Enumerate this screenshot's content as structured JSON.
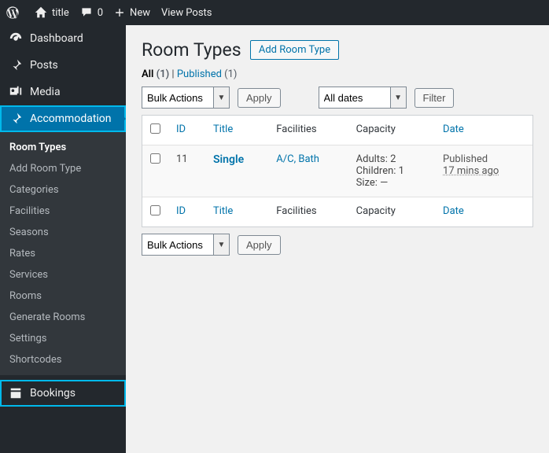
{
  "adminbar": {
    "site_title": "title",
    "comments_count": "0",
    "new_label": "New",
    "view_posts": "View Posts"
  },
  "sidebar": {
    "dashboard": "Dashboard",
    "posts": "Posts",
    "media": "Media",
    "accommodation": "Accommodation",
    "bookings": "Bookings",
    "submenu": {
      "room_types": "Room Types",
      "add_room_type": "Add Room Type",
      "categories": "Categories",
      "facilities": "Facilities",
      "seasons": "Seasons",
      "rates": "Rates",
      "services": "Services",
      "rooms": "Rooms",
      "generate_rooms": "Generate Rooms",
      "settings": "Settings",
      "shortcodes": "Shortcodes"
    }
  },
  "page": {
    "title": "Room Types",
    "add_button": "Add Room Type"
  },
  "filters": {
    "all": "All",
    "all_count": "(1)",
    "published": "Published",
    "published_count": "(1)",
    "sep": " | "
  },
  "bulk": {
    "label": "Bulk Actions",
    "apply": "Apply"
  },
  "date_filter": {
    "all_dates": "All dates",
    "filter": "Filter"
  },
  "table": {
    "cols": {
      "id": "ID",
      "title": "Title",
      "facilities": "Facilities",
      "capacity": "Capacity",
      "date": "Date"
    },
    "rows": [
      {
        "id": "11",
        "title": "Single",
        "facilities": "A/C, Bath",
        "capacity_adults": "Adults: 2",
        "capacity_children": "Children: 1",
        "capacity_size": "Size: —",
        "date_status": "Published",
        "date_ago": "17 mins ago"
      }
    ]
  }
}
